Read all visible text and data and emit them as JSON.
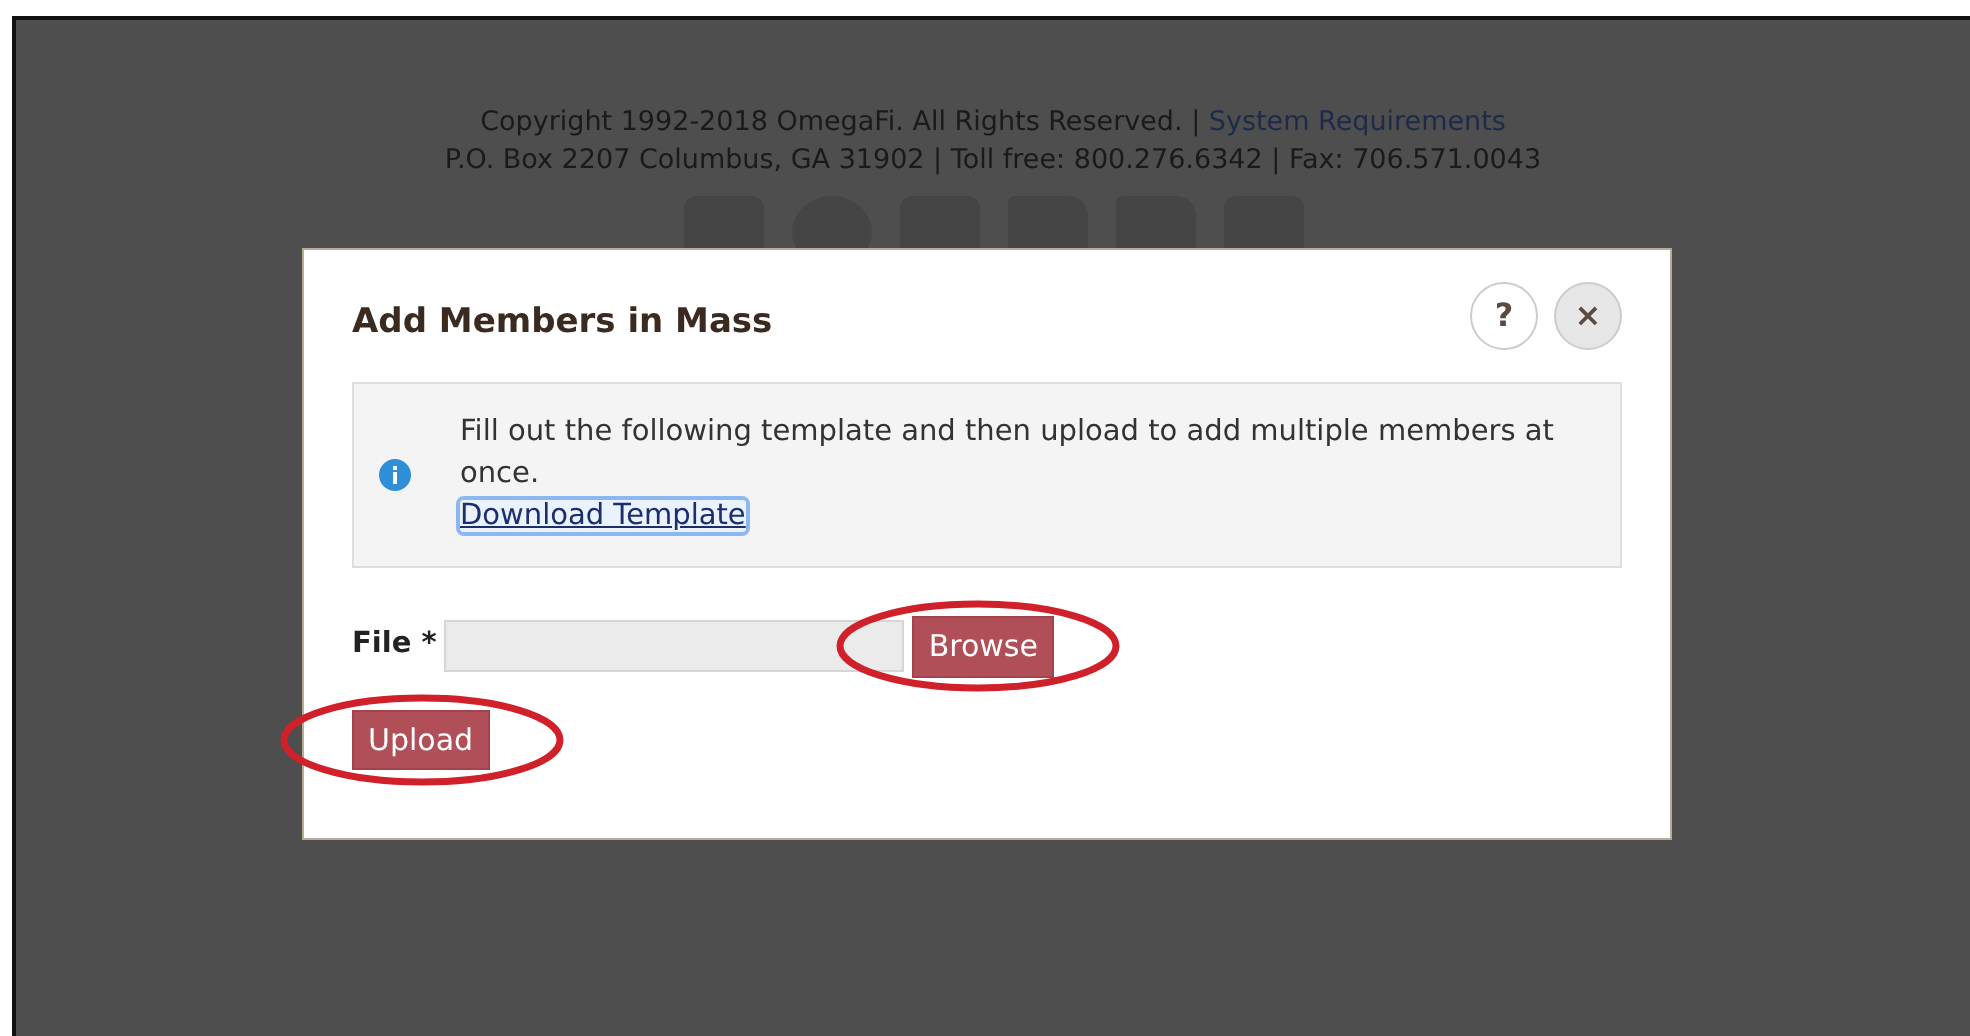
{
  "footer": {
    "copyright": "Copyright 1992-2018 OmegaFi. All Rights Reserved. |",
    "link": "System Requirements",
    "address": "P.O. Box 2207 Columbus, GA 31902 | Toll free: 800.276.6342 | Fax: 706.571.0043"
  },
  "modal": {
    "title": "Add Members in Mass",
    "help_button": "?",
    "close_button": "×",
    "info": {
      "message": "Fill out the following template and then upload to add multiple members at once.",
      "link": "Download Template",
      "link_focused": true
    },
    "file_field": {
      "label": "File",
      "required_mark": "*",
      "browse_button": "Browse",
      "browse_circled": true
    },
    "upload_button": "Upload",
    "upload_circled": true
  }
}
